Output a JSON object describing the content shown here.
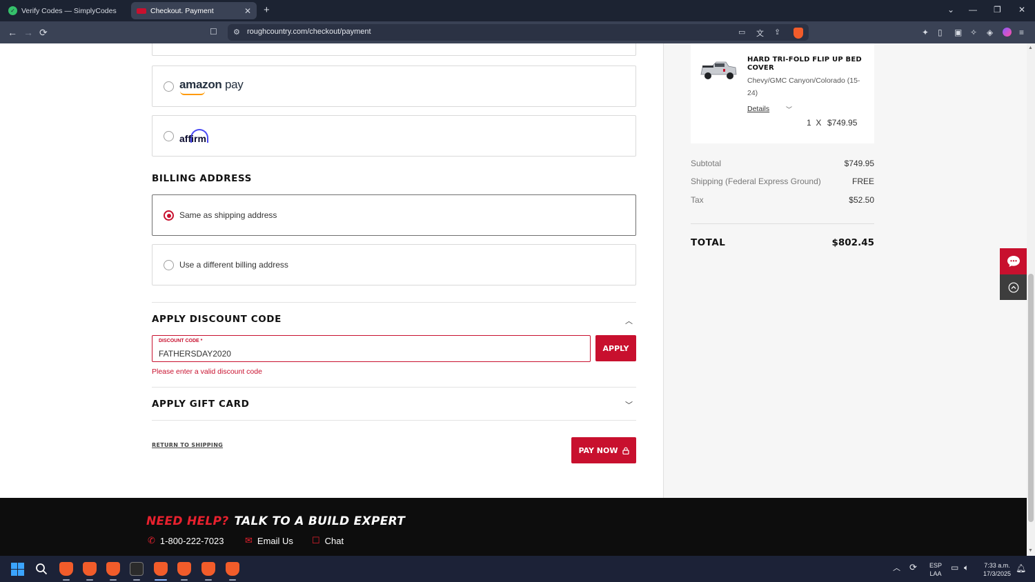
{
  "browser": {
    "tabs": [
      {
        "title": "Verify Codes — SimplyCodes",
        "active": false
      },
      {
        "title": "Checkout. Payment",
        "active": true
      }
    ],
    "url": "roughcountry.com/checkout/payment",
    "icons": {
      "back": "←",
      "forward": "→",
      "reload": "⟳",
      "bookmark": "☐",
      "new_tab": "+",
      "minimize": "—",
      "restore": "❐",
      "close": "✕",
      "tab_list": "⌄"
    }
  },
  "payment_options": [
    {
      "brand": "amazon",
      "label_main": "amazon",
      "label_sub": "pay",
      "selected": false
    },
    {
      "brand": "affirm",
      "label_main": "affirm",
      "selected": false
    }
  ],
  "billing": {
    "title": "BILLING ADDRESS",
    "options": [
      {
        "label": "Same as shipping address",
        "selected": true
      },
      {
        "label": "Use a different billing address",
        "selected": false
      }
    ]
  },
  "discount": {
    "title": "APPLY DISCOUNT CODE",
    "field_label": "DISCOUNT CODE *",
    "value": "FATHERSDAY2020",
    "apply_label": "APPLY",
    "error": "Please enter a valid discount code",
    "expanded": true
  },
  "gift_card": {
    "title": "APPLY GIFT CARD",
    "expanded": false
  },
  "actions": {
    "return_label": "RETURN TO SHIPPING",
    "pay_label": "PAY NOW"
  },
  "summary": {
    "product": {
      "title": "HARD TRI-FOLD FLIP UP BED COVER",
      "variant": "Chevy/GMC Canyon/Colorado (15-24)",
      "details_label": "Details",
      "qty": "1",
      "qty_sep": "X",
      "price": "$749.95"
    },
    "rows": [
      {
        "label": "Subtotal",
        "value": "$749.95"
      },
      {
        "label": "Shipping (Federal Express Ground)",
        "value": "FREE"
      },
      {
        "label": "Tax",
        "value": "$52.50"
      }
    ],
    "total_label": "TOTAL",
    "total_value": "$802.45"
  },
  "footer": {
    "need_help": "NEED HELP?",
    "talk": "TALK TO A BUILD EXPERT",
    "phone": "1-800-222-7023",
    "email": "Email Us",
    "chat": "Chat"
  },
  "taskbar": {
    "lang_top": "ESP",
    "lang_bottom": "LAA",
    "time": "7:33 a.m.",
    "date": "17/3/2025"
  },
  "colors": {
    "brand_red": "#c8102e",
    "footer_red": "#e8212e",
    "chrome_dark": "#1c2332"
  }
}
